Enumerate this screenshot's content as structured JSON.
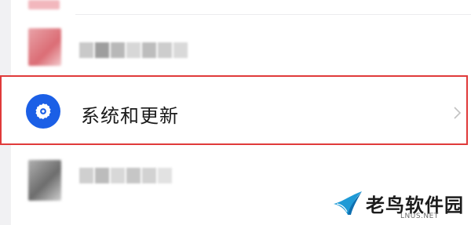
{
  "settings_list": {
    "highlighted_item": {
      "icon": "gear-icon",
      "label": "系统和更新",
      "accent_color": "#1b5fe6",
      "highlight_color": "#e03a3a"
    }
  },
  "watermark": {
    "title": "老鸟软件园",
    "domain": "LNUS.NET"
  }
}
